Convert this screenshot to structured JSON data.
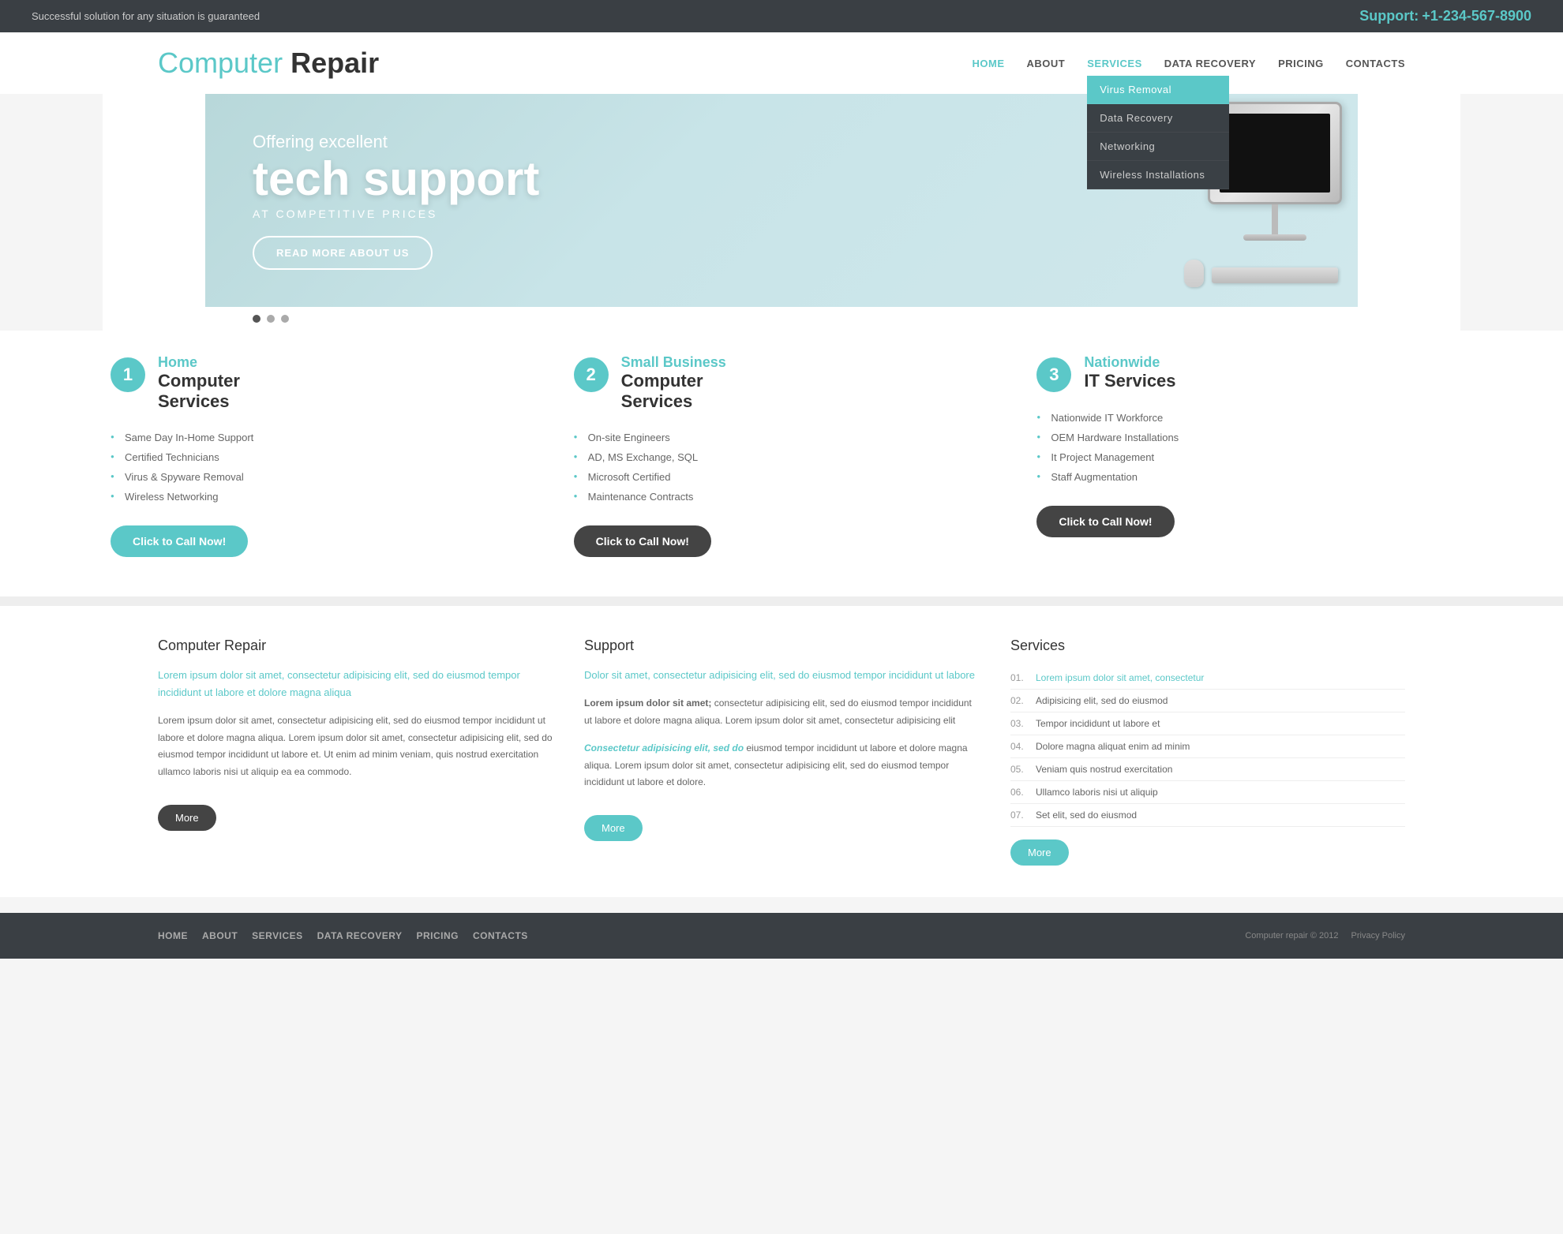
{
  "topbar": {
    "tagline": "Successful solution for any situation is guaranteed",
    "support_label": "Support:",
    "phone": "+1-234-567-8900"
  },
  "header": {
    "logo_part1": "Computer",
    "logo_part2": " Repair",
    "nav": {
      "items": [
        {
          "label": "HOME",
          "active": true,
          "id": "home"
        },
        {
          "label": "ABOUT",
          "active": false,
          "id": "about"
        },
        {
          "label": "SERVICES",
          "active": false,
          "id": "services",
          "dropdown": true
        },
        {
          "label": "DATA RECOVERY",
          "active": false,
          "id": "data-recovery"
        },
        {
          "label": "PRICING",
          "active": false,
          "id": "pricing"
        },
        {
          "label": "CONTACTS",
          "active": false,
          "id": "contacts"
        }
      ],
      "dropdown_items": [
        {
          "label": "Virus Removal",
          "active": true
        },
        {
          "label": "Data Recovery",
          "active": false
        },
        {
          "label": "Networking",
          "active": false
        },
        {
          "label": "Wireless Installations",
          "active": false
        }
      ]
    }
  },
  "hero": {
    "offering": "Offering excellent",
    "headline1": "tech support",
    "headline2": "AT COMPETITIVE PRICES",
    "button_label": "READ MORE ABOUT US"
  },
  "slider": {
    "dots": [
      {
        "active": true
      },
      {
        "active": false
      },
      {
        "active": false
      }
    ]
  },
  "services": [
    {
      "num": "1",
      "title_colored": "Home",
      "title_dark": "Computer\nServices",
      "items": [
        "Same Day In-Home Support",
        "Certified Technicians",
        "Virus & Spyware Removal",
        "Wireless Networking"
      ],
      "button_label": "Click to Call Now!",
      "button_style": "teal"
    },
    {
      "num": "2",
      "title_colored": "Small Business",
      "title_dark": "Computer\nServices",
      "items": [
        "On-site Engineers",
        "AD, MS Exchange, SQL",
        "Microsoft Certified",
        "Maintenance Contracts"
      ],
      "button_label": "Click to Call Now!",
      "button_style": "dark"
    },
    {
      "num": "3",
      "title_colored": "Nationwide",
      "title_dark": "IT Services",
      "items": [
        "Nationwide IT Workforce",
        "OEM Hardware Installations",
        "It Project Management",
        "Staff Augmentation"
      ],
      "button_label": "Click to Call Now!",
      "button_style": "dark"
    }
  ],
  "info": {
    "col1": {
      "heading": "Computer Repair",
      "highlight": "Lorem ipsum dolor sit amet, consectetur adipisicing elit, sed do eiusmod tempor incididunt ut labore et dolore magna aliqua",
      "body": "Lorem ipsum dolor sit amet, consectetur adipisicing elit, sed do eiusmod tempor incididunt ut labore et dolore magna aliqua.  Lorem ipsum dolor sit amet, consectetur adipisicing elit, sed do eiusmod tempor incididunt ut labore et. Ut enim ad minim veniam, quis nostrud exercitation ullamco laboris nisi ut aliquip ea ea commodo.",
      "more_label": "More",
      "more_style": "dark"
    },
    "col2": {
      "heading": "Support",
      "highlight": "Dolor sit amet, consectetur adipisicing elit, sed do eiusmod tempor incididunt ut labore",
      "body1": "Lorem ipsum dolor sit amet, consectetur adipisicing elit, sed do eiusmod tempor incididunt ut labore et dolore magna aliqua.  Lorem ipsum dolor sit amet, consectetur adipisicing elit",
      "body2_bold": "Consectetur adipisicing elit, sed do",
      "body2": "eiusmod tempor incididunt ut labore et dolore magna aliqua.  Lorem ipsum dolor sit amet, consectetur adipisicing elit, sed do eiusmod tempor incididunt ut labore et dolore.",
      "more_label": "More",
      "more_style": "teal"
    },
    "col3": {
      "heading": "Services",
      "items": [
        {
          "num": "01.",
          "label": "Lorem ipsum dolor sit amet, consectetur",
          "highlight": true
        },
        {
          "num": "02.",
          "label": "Adipisicing elit, sed do eiusmod",
          "highlight": false
        },
        {
          "num": "03.",
          "label": "Tempor incididunt ut labore et",
          "highlight": false
        },
        {
          "num": "04.",
          "label": "Dolore magna aliquat enim ad minim",
          "highlight": false
        },
        {
          "num": "05.",
          "label": "Veniam quis nostrud exercitation",
          "highlight": false
        },
        {
          "num": "06.",
          "label": "Ullamco laboris nisi ut aliquip",
          "highlight": false
        },
        {
          "num": "07.",
          "label": "Set elit, sed do eiusmod",
          "highlight": false
        }
      ],
      "more_label": "More",
      "more_style": "teal"
    }
  },
  "footer": {
    "nav_items": [
      {
        "label": "Home"
      },
      {
        "label": "About"
      },
      {
        "label": "Services"
      },
      {
        "label": "Data Recovery"
      },
      {
        "label": "Pricing"
      },
      {
        "label": "Contacts"
      }
    ],
    "copyright": "Computer repair © 2012",
    "privacy": "Privacy Policy"
  }
}
